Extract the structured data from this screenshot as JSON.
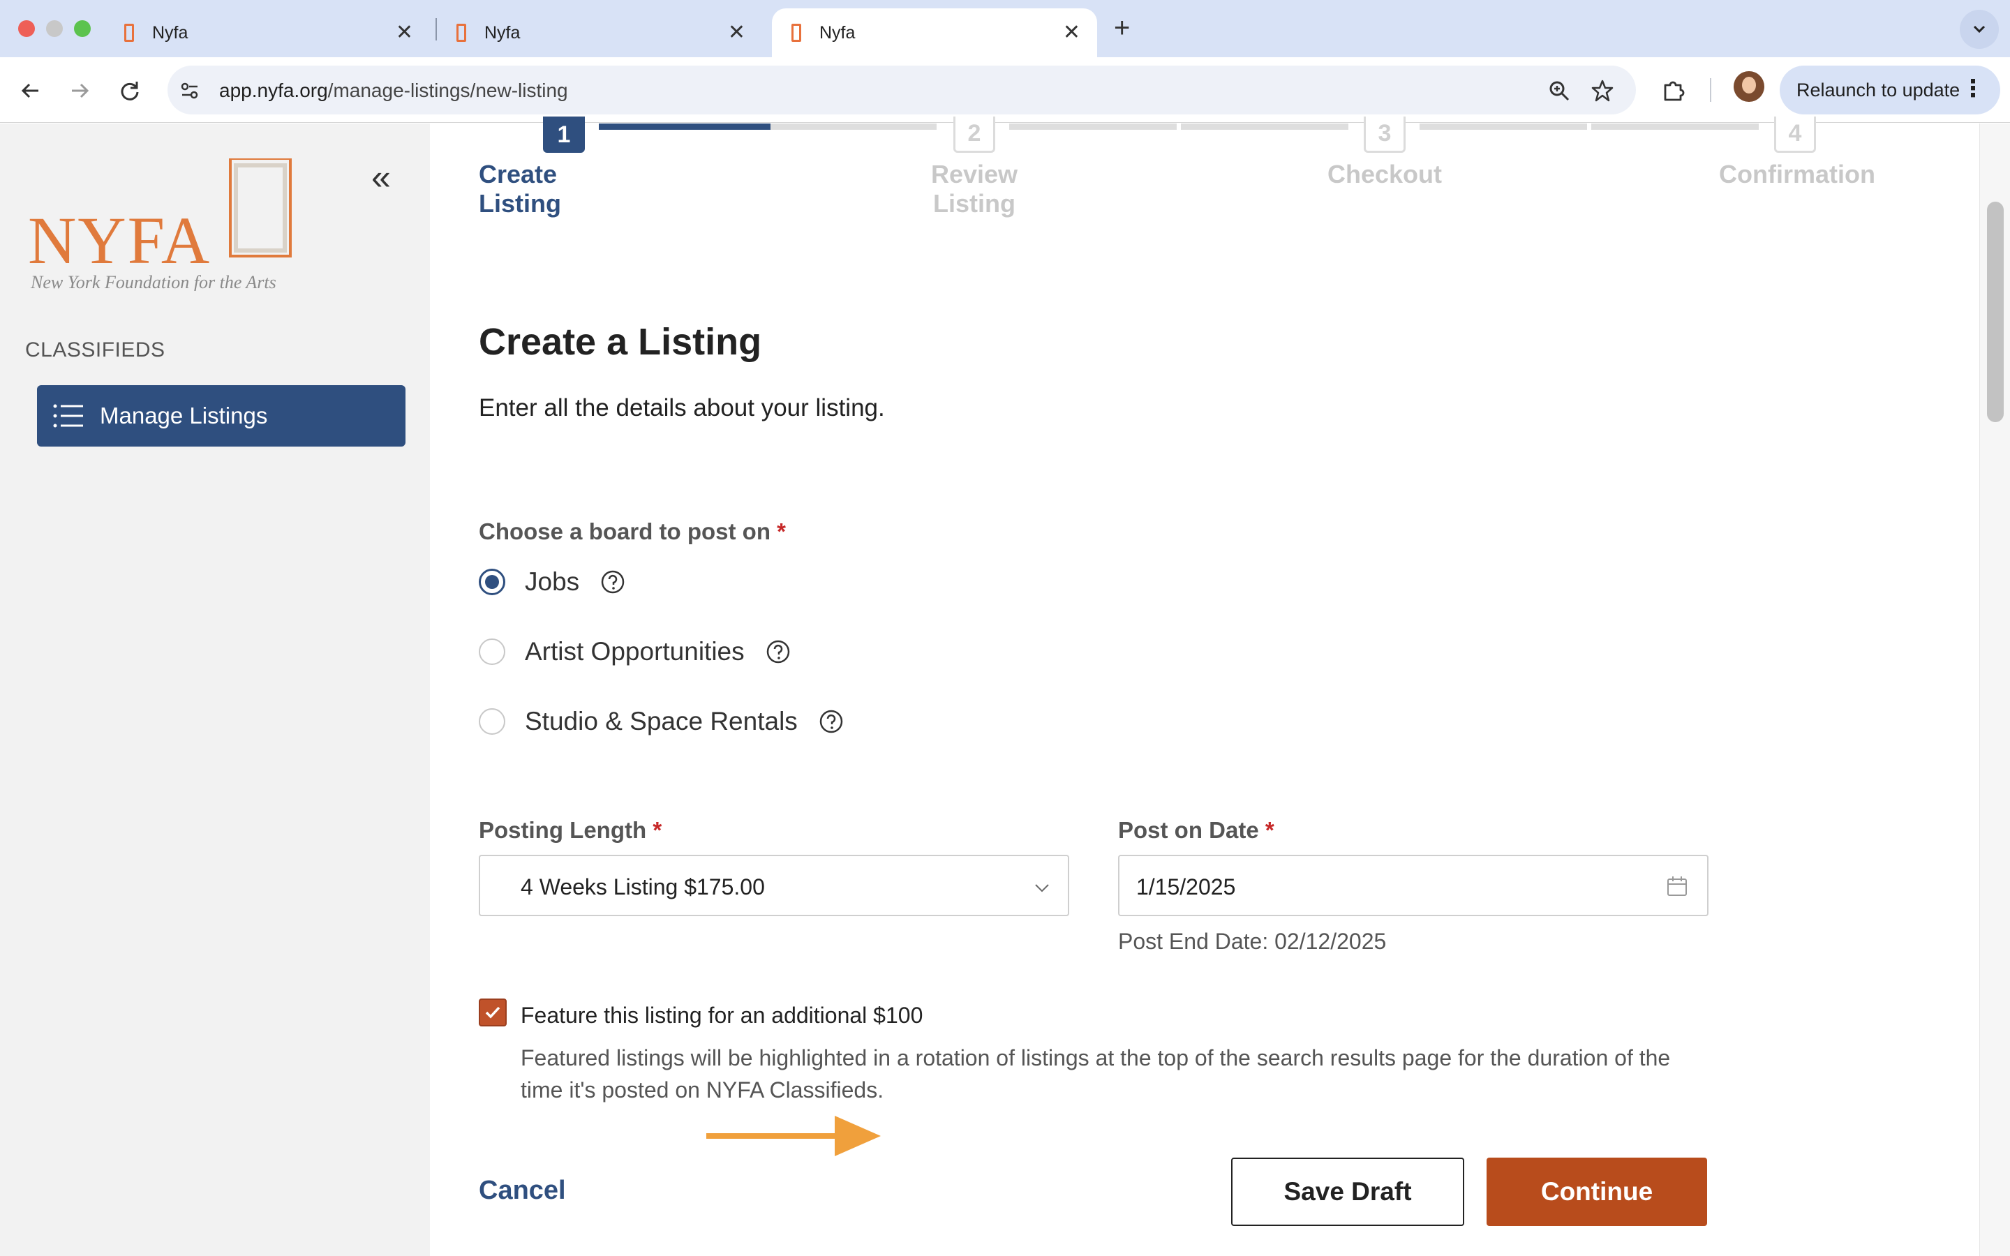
{
  "browser": {
    "tabs": [
      {
        "title": "Nyfa",
        "active": false
      },
      {
        "title": "Nyfa",
        "active": false
      },
      {
        "title": "Nyfa",
        "active": true
      }
    ],
    "url_host": "app.nyfa.org",
    "url_path": "/manage-listings/new-listing",
    "relaunch_label": "Relaunch to update",
    "traffic_colors": [
      "#ee5f57",
      "#c8c8c8",
      "#5cc34e"
    ]
  },
  "sidebar": {
    "logo_text": "NYFA",
    "logo_tagline": "New York Foundation for the Arts",
    "section_label": "CLASSIFIEDS",
    "items": [
      {
        "label": "Manage Listings",
        "icon": "list-icon",
        "active": true
      }
    ]
  },
  "stepper": {
    "steps": [
      {
        "number": "1",
        "label": "Create Listing",
        "state": "active"
      },
      {
        "number": "2",
        "label": "Review Listing",
        "state": "inactive"
      },
      {
        "number": "3",
        "label": "Checkout",
        "state": "inactive"
      },
      {
        "number": "4",
        "label": "Confirmation",
        "state": "inactive"
      }
    ]
  },
  "form": {
    "title": "Create a Listing",
    "subtitle": "Enter all the details about your listing.",
    "board_label": "Choose a board to post on",
    "required_mark": "*",
    "boards": [
      {
        "label": "Jobs",
        "checked": true
      },
      {
        "label": "Artist Opportunities",
        "checked": false
      },
      {
        "label": "Studio & Space Rentals",
        "checked": false
      }
    ],
    "posting_length_label": "Posting Length",
    "posting_length_value": "4 Weeks Listing $175.00",
    "post_date_label": "Post on Date",
    "post_date_value": "1/15/2025",
    "post_end_date": "Post End Date: 02/12/2025",
    "feature_checked": true,
    "feature_label": "Feature this listing for an additional $100",
    "feature_description": "Featured listings will be highlighted in a rotation of listings at the top of the search results page for the duration of the time it's posted on NYFA Classifieds.",
    "cancel_label": "Cancel",
    "save_draft_label": "Save Draft",
    "continue_label": "Continue"
  },
  "colors": {
    "brand_navy": "#2f4f7f",
    "brand_orange": "#b84c1c",
    "logo_orange": "#e07a3c",
    "annotation_arrow": "#f0a03c"
  }
}
